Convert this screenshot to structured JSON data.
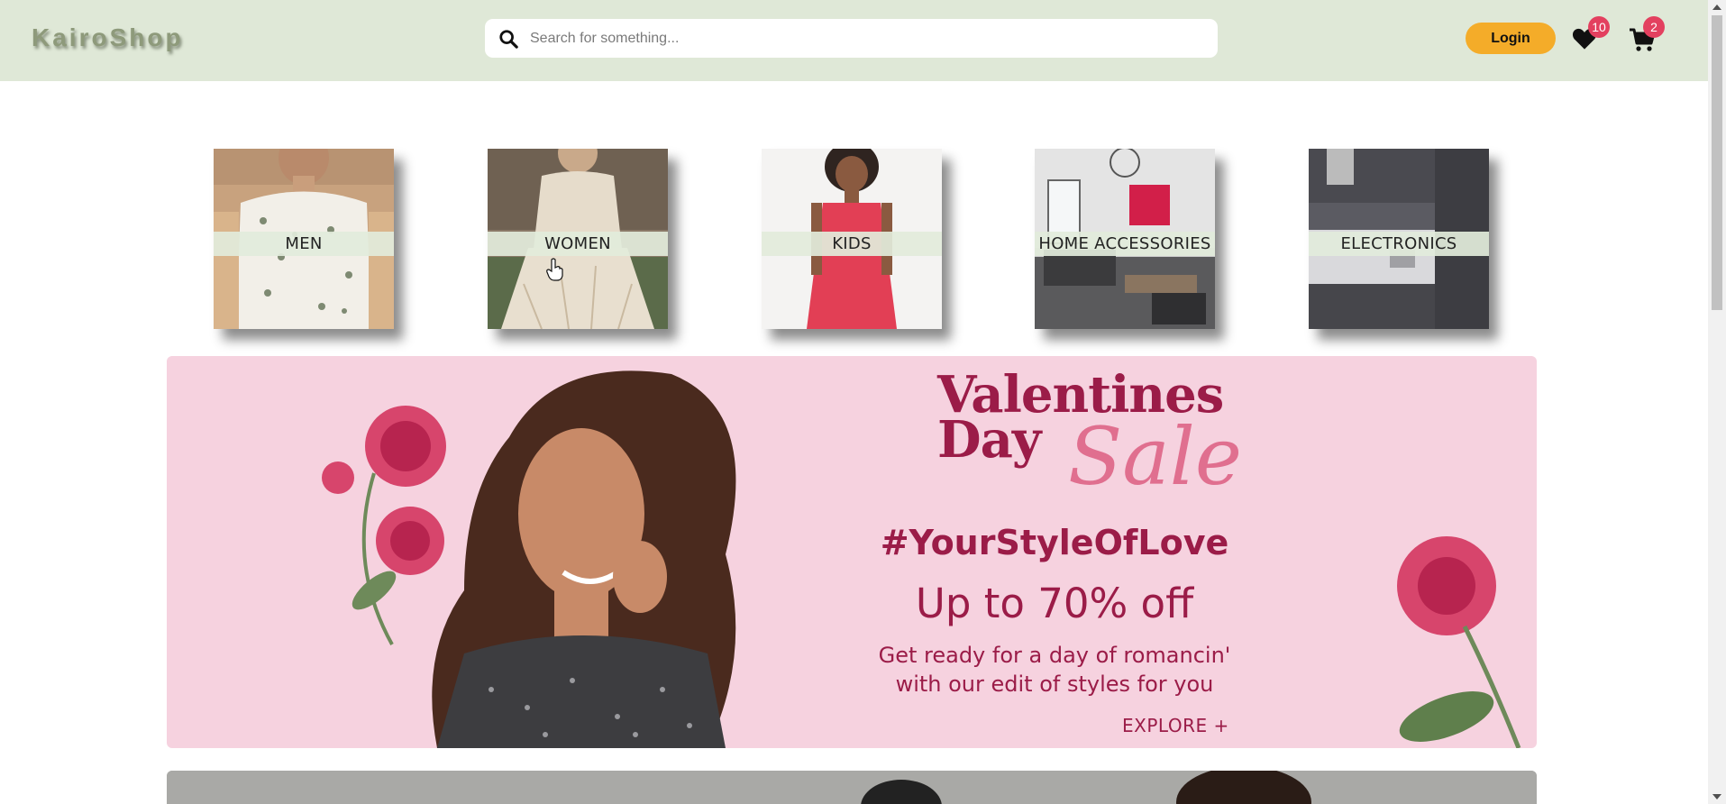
{
  "header": {
    "logo": "KairoShop",
    "search_placeholder": "Search for something...",
    "login_label": "Login",
    "wishlist_count": "10",
    "cart_count": "2",
    "colors": {
      "header_bg": "#dfe8d7",
      "login_bg": "#f4ac29",
      "badge_bg": "#e3405f"
    }
  },
  "categories": [
    {
      "label": "MEN",
      "icon": "men-category-image"
    },
    {
      "label": "WOMEN",
      "icon": "women-category-image"
    },
    {
      "label": "KIDS",
      "icon": "kids-category-image"
    },
    {
      "label": "HOME ACCESSORIES",
      "icon": "home-accessories-category-image"
    },
    {
      "label": "ELECTRONICS",
      "icon": "electronics-category-image"
    }
  ],
  "banner": {
    "title_line1": "Valentines",
    "title_line2": "Day",
    "title_script": "Sale",
    "hashtag": "#YourStyleOfLove",
    "offer": "Up to 70% off",
    "subtitle_line1": "Get ready for a day of romancin'",
    "subtitle_line2": "with our edit of styles for you",
    "cta": "EXPLORE +",
    "colors": {
      "bg": "#f6d2df",
      "text": "#9b1c48",
      "script": "#e06f8f"
    }
  }
}
